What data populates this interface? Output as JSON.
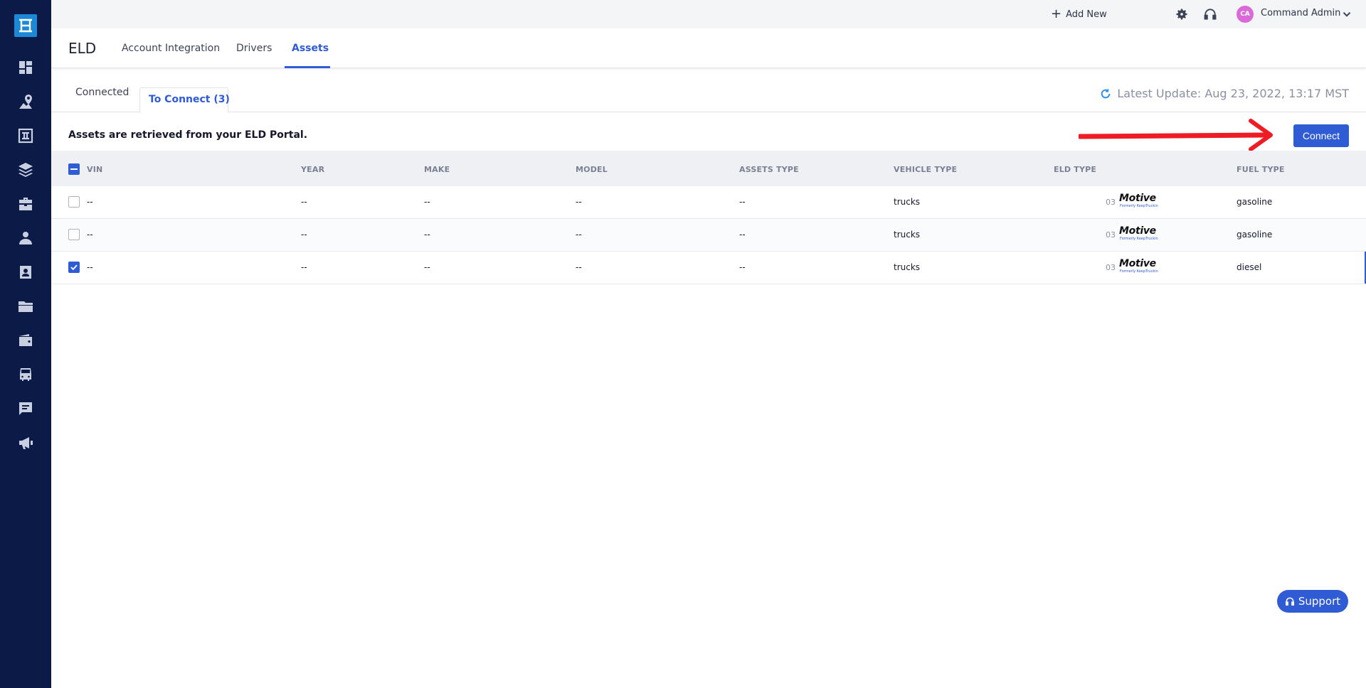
{
  "sidebar": {
    "logo": "app-logo",
    "items": [
      {
        "name": "dashboard-icon"
      },
      {
        "name": "map-route-icon"
      },
      {
        "name": "dispatch-board-icon"
      },
      {
        "name": "layers-icon"
      },
      {
        "name": "briefcase-icon"
      },
      {
        "name": "driver-icon"
      },
      {
        "name": "contact-card-icon"
      },
      {
        "name": "folder-icon"
      },
      {
        "name": "wallet-icon"
      },
      {
        "name": "truck-icon"
      },
      {
        "name": "message-icon"
      },
      {
        "name": "megaphone-icon"
      }
    ]
  },
  "topbar": {
    "add_new": "Add New",
    "avatar_initials": "CA",
    "user_name": "Command Admin"
  },
  "header": {
    "title": "ELD",
    "tabs": [
      "Account Integration",
      "Drivers",
      "Assets"
    ],
    "active_tab": "Assets"
  },
  "subtabs": {
    "items": [
      "Connected",
      "To Connect (3)"
    ],
    "active": "To Connect (3)",
    "latest_update": "Latest Update: Aug 23, 2022, 13:17 MST"
  },
  "info": {
    "text": "Assets are retrieved from your ELD Portal.",
    "connect_label": "Connect"
  },
  "table": {
    "columns": [
      "VIN",
      "YEAR",
      "MAKE",
      "MODEL",
      "ASSETS TYPE",
      "VEHICLE TYPE",
      "ELD TYPE",
      "FUEL TYPE"
    ],
    "rows": [
      {
        "checked": false,
        "vin": "--",
        "year": "--",
        "make": "--",
        "model": "--",
        "assets_type": "--",
        "vehicle_type": "trucks",
        "eld_num": "03",
        "eld_brand": "Motive",
        "eld_sub": "Formerly KeepTruckin",
        "fuel_type": "gasoline"
      },
      {
        "checked": false,
        "vin": "--",
        "year": "--",
        "make": "--",
        "model": "--",
        "assets_type": "--",
        "vehicle_type": "trucks",
        "eld_num": "03",
        "eld_brand": "Motive",
        "eld_sub": "Formerly KeepTruckin",
        "fuel_type": "gasoline"
      },
      {
        "checked": true,
        "vin": "--",
        "year": "--",
        "make": "--",
        "model": "--",
        "assets_type": "--",
        "vehicle_type": "trucks",
        "eld_num": "03",
        "eld_brand": "Motive",
        "eld_sub": "Formerly KeepTruckin",
        "fuel_type": "diesel"
      }
    ]
  },
  "support": {
    "label": "Support"
  },
  "colors": {
    "accent": "#2f5bd4",
    "sidebar": "#0c1a47",
    "logo": "#1e88d8",
    "annotation_arrow": "#ee1c25",
    "avatar": "#d96ad8"
  }
}
